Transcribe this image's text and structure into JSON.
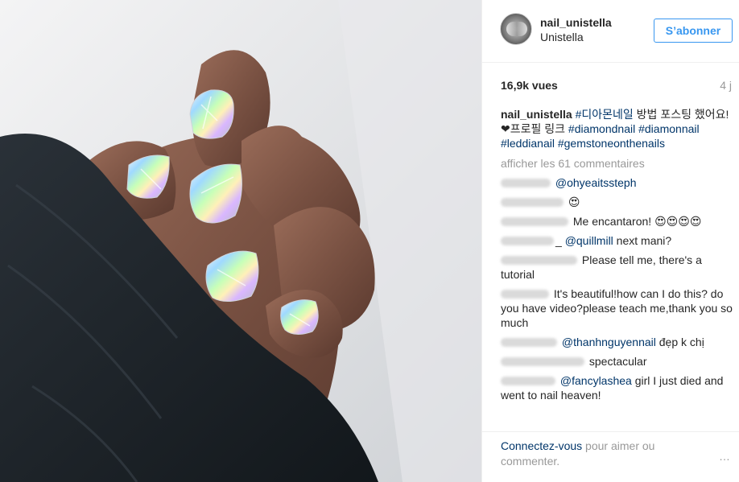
{
  "post": {
    "username": "nail_unistella",
    "full_name": "Unistella",
    "follow_label": "S’abonner",
    "views": "16,9k vues",
    "age": "4 j"
  },
  "caption": {
    "author": "nail_unistella",
    "tag1": "#디아몬네일",
    "text1": " 방법 포스팅 했어요! ❤프로필 링크 ",
    "tag2": "#diamondnail",
    "tag3": "#diamonnail",
    "tag4": "#leddianail",
    "tag5": "#gemstoneonthenails"
  },
  "load_more": "afficher les 61 commentaires",
  "comments": [
    {
      "mention": "@ohyeaitssteph",
      "text": ""
    },
    {
      "mention": "",
      "text": "😍"
    },
    {
      "mention": "",
      "text": "Me encantaron! 😍😍😍😍"
    },
    {
      "mention": "@quillmill",
      "text": " next mani?"
    },
    {
      "mention": "",
      "text": "Please tell me, there's a tutorial"
    },
    {
      "mention": "",
      "text": "It's beautiful!how can I do this? do you have video?please teach me,thank you so much"
    },
    {
      "mention": "@thanhnguyennail",
      "text": " đẹp k chị"
    },
    {
      "mention": "",
      "text": "spectacular"
    },
    {
      "mention": "@fancylashea",
      "text": " girl I just died and went to nail heaven!"
    }
  ],
  "comment_name_suffix": "_",
  "footer": {
    "login_link": "Connectez-vous",
    "login_rest": " pour aimer ou commenter.",
    "more": "…"
  },
  "colors": {
    "accent": "#3897f0",
    "link": "#003569",
    "muted": "#999999",
    "sleeve": "#1d2329",
    "skin": "#7a5546"
  }
}
